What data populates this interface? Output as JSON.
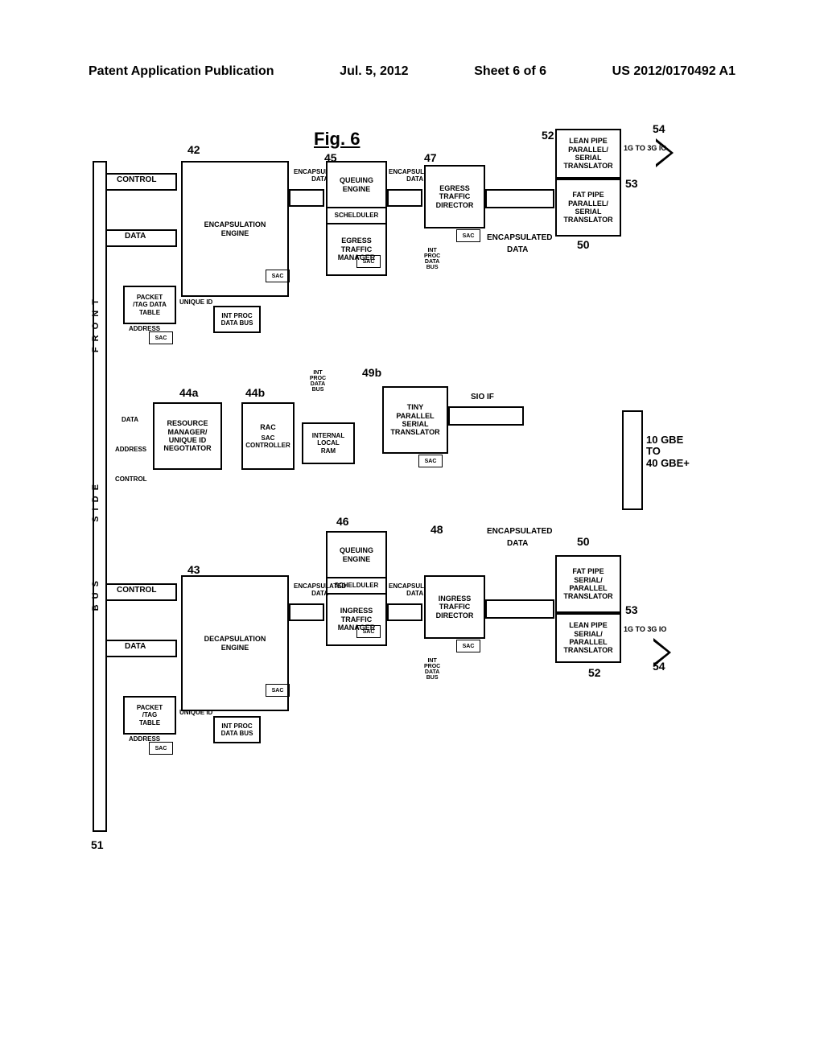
{
  "header": {
    "left": "Patent Application Publication",
    "center": "Jul. 5, 2012",
    "sheet": "Sheet 6 of 6",
    "right": "US 2012/0170492 A1"
  },
  "figure_label": "Fig. 6",
  "refs": {
    "r42": "42",
    "r43": "43",
    "r44a": "44a",
    "r44b": "44b",
    "r45": "45",
    "r46": "46",
    "r47": "47",
    "r48": "48",
    "r49b": "49b",
    "r50t": "50",
    "r50b": "50",
    "r51": "51",
    "r52t": "52",
    "r52b": "52",
    "r53t": "53",
    "r53b": "53",
    "r54t": "54",
    "r54b": "54"
  },
  "bus_labels": {
    "front": "F R O N T",
    "side": "S I D E",
    "bus": "B U S"
  },
  "flows": {
    "control": "CONTROL",
    "data": "DATA",
    "address": "ADDRESS",
    "unique_id": "UNIQUE ID",
    "encapsulated_data": "ENCAPSULATED\nDATA",
    "encapsulated": "ENCAPSULATED",
    "sio_if": "SIO IF",
    "int_proc_data_bus": "INT\nPROC\nDATA\nBUS",
    "scheduler": "SCHELDULER"
  },
  "io": {
    "gbe": "10 GBE\nTO\n40 GBE+",
    "gio": "1G TO 3G IO"
  },
  "boxes": {
    "encapsulation_engine": "ENCAPSULATION\nENGINE",
    "decapsulation_engine": "DECAPSULATION\nENGINE",
    "packet_tag_data_table": "PACKET\n/TAG DATA\nTABLE",
    "packet_tag_table": "PACKET\n/TAG\nTABLE",
    "int_proc_databus": "INT PROC\nDATA BUS",
    "resource_manager": "RESOURCE\nMANAGER/\nUNIQUE ID\nNEGOTIATOR",
    "rac": "RAC",
    "sac_controller": "SAC\nCONTROLLER",
    "internal_local_ram": "INTERNAL\nLOCAL\nRAM",
    "tiny_translator": "TINY\nPARALLEL\nSERIAL\nTRANSLATOR",
    "queuing_engine": "QUEUING\nENGINE",
    "egress_traffic_manager": "EGRESS\nTRAFFIC\nMANAGER",
    "ingress_traffic_manager": "INGRESS\nTRAFFIC\nMANAGER",
    "egress_traffic_director": "EGRESS\nTRAFFIC\nDIRECTOR",
    "ingress_traffic_director": "INGRESS\nTRAFFIC\nDIRECTOR",
    "fat_pipe_ps": "FAT PIPE\nPARALLEL/\nSERIAL\nTRANSLATOR",
    "fat_pipe_sp": "FAT PIPE\nSERIAL/\nPARALLEL\nTRANSLATOR",
    "lean_pipe_ps": "LEAN PIPE\nPARALLEL/\nSERIAL\nTRANSLATOR",
    "lean_pipe_sp": "LEAN PIPE\nSERIAL/\nPARALLEL\nTRANSLATOR",
    "sac": "SAC"
  }
}
